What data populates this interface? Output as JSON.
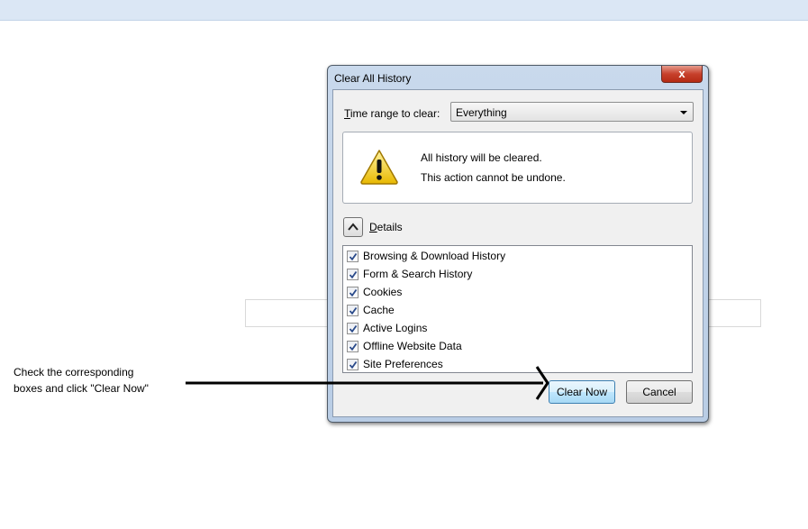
{
  "dialog": {
    "title": "Clear All History",
    "close_label": "x",
    "time_range": {
      "label_prefix": "T",
      "label_rest": "ime range to clear:",
      "selected": "Everything"
    },
    "warning": {
      "line1": "All history will be cleared.",
      "line2": "This action cannot be undone."
    },
    "details": {
      "label_prefix": "D",
      "label_rest": "etails"
    },
    "items": [
      {
        "label": "Browsing & Download History",
        "checked": true
      },
      {
        "label": "Form & Search History",
        "checked": true
      },
      {
        "label": "Cookies",
        "checked": true
      },
      {
        "label": "Cache",
        "checked": true
      },
      {
        "label": "Active Logins",
        "checked": true
      },
      {
        "label": "Offline Website Data",
        "checked": true
      },
      {
        "label": "Site Preferences",
        "checked": true
      }
    ],
    "buttons": {
      "clear_now": "Clear Now",
      "cancel": "Cancel"
    }
  },
  "annotation": {
    "line1": "Check the corresponding",
    "line2": "boxes and click \"Clear Now\""
  }
}
